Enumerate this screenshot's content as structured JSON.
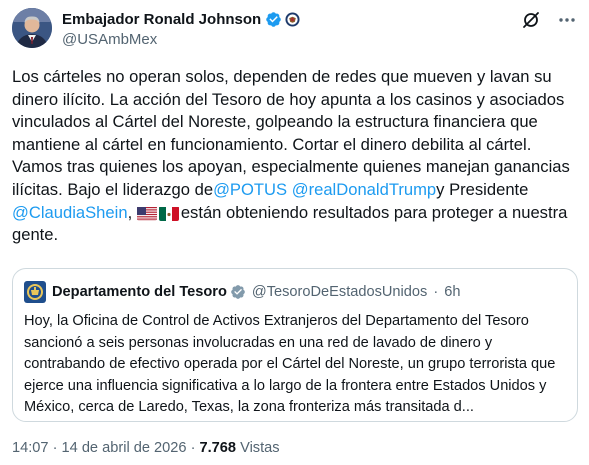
{
  "author": {
    "display_name": "Embajador Ronald Johnson",
    "handle": "@USAmbMex",
    "avatar_icon": "avatar-ambassador-portrait",
    "badges": [
      "verified-badge-icon",
      "us-embassy-seal-icon"
    ]
  },
  "header_actions": {
    "grok_icon": "grok-icon",
    "more_icon": "more-icon"
  },
  "tweet": {
    "text_1": "Los cárteles no operan solos, dependen de redes que mueven y lavan su dinero ilícito. La acción del Tesoro de hoy apunta a los casinos y asociados vinculados al Cártel del Noreste, golpeando la estructura financiera que mantiene al cártel en funcionamiento. Cortar el dinero debilita al cártel. Vamos tras quienes los apoyan, especialmente quienes manejan ganancias ilícitas. Bajo el liderazgo de",
    "mention_1": "@POTUS",
    "mention_2": "@realDonaldTrump",
    "text_2": "y Presidente",
    "mention_3": "@ClaudiaShein",
    "text_3": ",",
    "flags": [
      "us-flag-emoji",
      "mexico-flag-emoji"
    ],
    "text_4": "están obteniendo resultados para proteger a nuestra gente."
  },
  "quoted": {
    "display_name": "Departamento del Tesoro",
    "handle": "@TesoroDeEstadosUnidos",
    "separator": "·",
    "age": "6h",
    "logo_icon": "treasury-seal-logo",
    "text": "Hoy, la Oficina de Control de Activos Extranjeros del Departamento del Tesoro sancionó a seis personas involucradas en una red de lavado de dinero y contrabando de efectivo operada por el Cártel del Noreste, un grupo terrorista que ejerce una influencia significativa a lo largo de la frontera entre Estados Unidos y México, cerca de Laredo, Texas, la zona fronteriza más transitada d..."
  },
  "meta": {
    "time": "14:07",
    "separator": "·",
    "date": "14 de abril de 2026",
    "views_count": "7.768",
    "views_label": "Vistas"
  },
  "colors": {
    "link": "#1d9bf0",
    "secondary_text": "#536471",
    "primary_text": "#0f1419",
    "border": "#cfd9de",
    "verified": "#1d9bf0"
  }
}
